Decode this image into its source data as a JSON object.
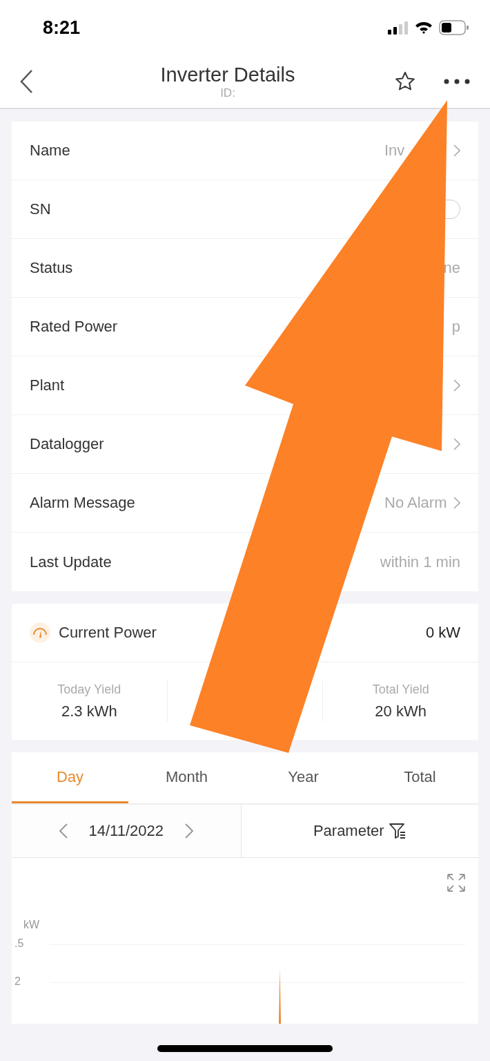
{
  "status_bar": {
    "time": "8:21"
  },
  "header": {
    "title": "Inverter Details",
    "subtitle": "ID:"
  },
  "details": [
    {
      "label": "Name",
      "value": "Inv",
      "kind": "link"
    },
    {
      "label": "SN",
      "kind": "pill"
    },
    {
      "label": "Status",
      "value": "ne",
      "kind": "plain"
    },
    {
      "label": "Rated Power",
      "value": "p",
      "kind": "plain"
    },
    {
      "label": "Plant",
      "kind": "link"
    },
    {
      "label": "Datalogger",
      "kind": "link"
    },
    {
      "label": "Alarm Message",
      "value": "No Alarm",
      "kind": "link"
    },
    {
      "label": "Last Update",
      "value": "within 1 min",
      "kind": "plain"
    }
  ],
  "power": {
    "label": "Current Power",
    "value": "0 kW",
    "stats": [
      {
        "label": "Today Yield",
        "value": "2.3 kWh"
      },
      {
        "label": "Total Yield",
        "value": "20 kWh"
      }
    ]
  },
  "tabs": [
    {
      "label": "Day",
      "selected": true
    },
    {
      "label": "Month",
      "selected": false
    },
    {
      "label": "Year",
      "selected": false
    },
    {
      "label": "Total",
      "selected": false
    }
  ],
  "date_bar": {
    "date": "14/11/2022",
    "parameter": "Parameter"
  },
  "chart": {
    "unit": "kW",
    "y_labels": [
      ".5",
      "2"
    ]
  }
}
